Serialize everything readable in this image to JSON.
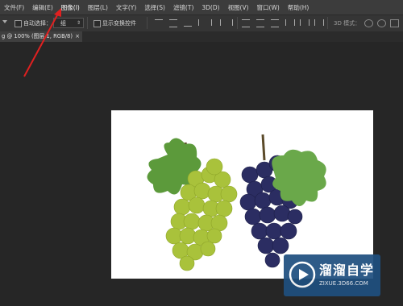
{
  "menubar": {
    "items": [
      "文件(F)",
      "编辑(E)",
      "图像(I)",
      "图层(L)",
      "文字(Y)",
      "选择(S)",
      "滤镜(T)",
      "3D(D)",
      "视图(V)",
      "窗口(W)",
      "帮助(H)"
    ],
    "active_index": 2
  },
  "options": {
    "auto_select_label": "自动选择：",
    "auto_select_value": "组",
    "show_transform_label": "显示变换控件",
    "mode_3d_label": "3D 模式："
  },
  "document_tab": {
    "title": "g @ 100% (图层 1, RGB/8)",
    "close": "×"
  },
  "annotation": {
    "arrow_color": "#e02020"
  },
  "watermark": {
    "brand": "溜溜自学",
    "url": "ZIXUE.3D66.COM"
  },
  "colors": {
    "menubar_bg": "#3c3c3c",
    "workspace_bg": "#262626",
    "green_grape": "#a8c43a",
    "purple_grape": "#2b2d62",
    "leaf": "#5a9a3a"
  }
}
